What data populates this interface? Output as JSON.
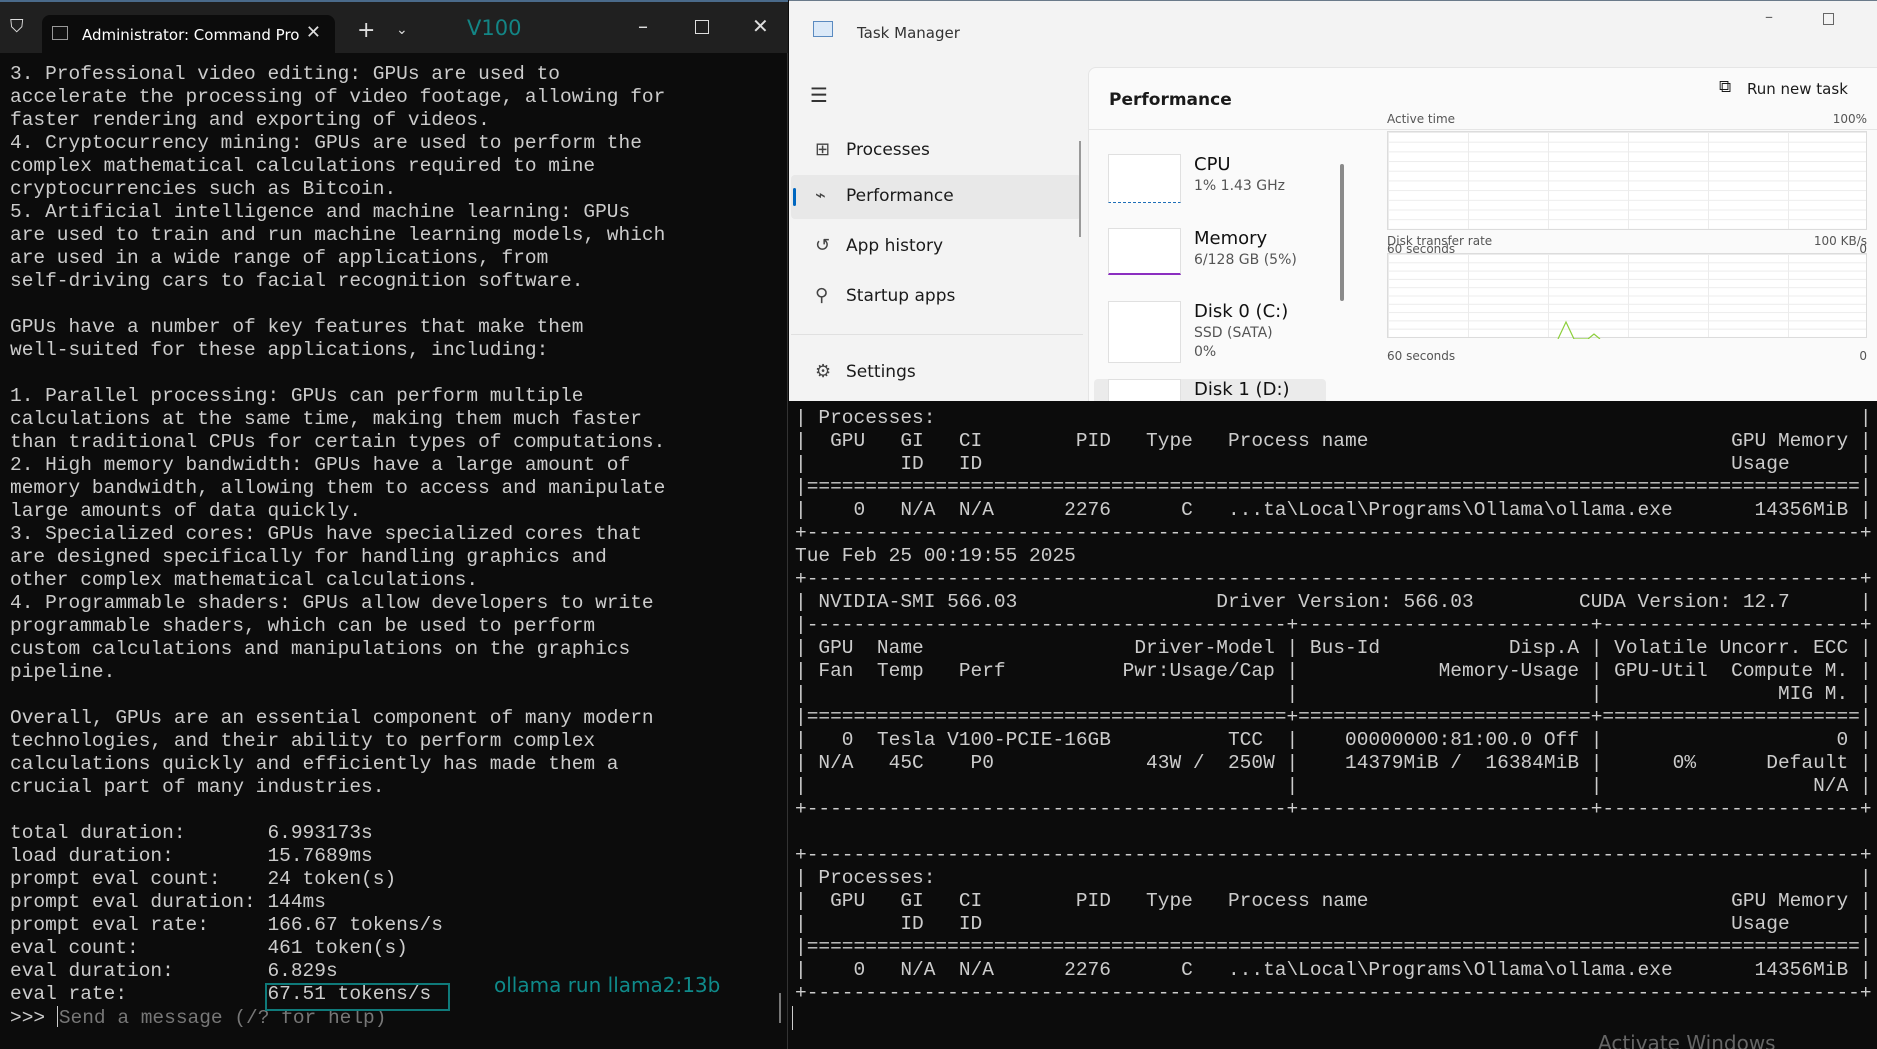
{
  "terminal": {
    "tab_title": "Administrator: Command Pro",
    "annotation_label": "V100",
    "lines": [
      "3. Professional video editing: GPUs are used to",
      "accelerate the processing of video footage, allowing for",
      "faster rendering and exporting of videos.",
      "4. Cryptocurrency mining: GPUs are used to perform the",
      "complex mathematical calculations required to mine",
      "cryptocurrencies such as Bitcoin.",
      "5. Artificial intelligence and machine learning: GPUs",
      "are used to train and run machine learning models, which",
      "are used in a wide range of applications, from",
      "self-driving cars to facial recognition software.",
      "",
      "GPUs have a number of key features that make them",
      "well-suited for these applications, including:",
      "",
      "1. Parallel processing: GPUs can perform multiple",
      "calculations at the same time, making them much faster",
      "than traditional CPUs for certain types of computations.",
      "2. High memory bandwidth: GPUs have a large amount of",
      "memory bandwidth, allowing them to access and manipulate",
      "large amounts of data quickly.",
      "3. Specialized cores: GPUs have specialized cores that",
      "are designed specifically for handling graphics and",
      "other complex mathematical calculations.",
      "4. Programmable shaders: GPUs allow developers to write",
      "programmable shaders, which can be used to perform",
      "custom calculations and manipulations on the graphics",
      "pipeline.",
      "",
      "Overall, GPUs are an essential component of many modern",
      "technologies, and their ability to perform complex",
      "calculations quickly and efficiently has made them a",
      "crucial part of many industries.",
      ""
    ],
    "stats": [
      {
        "label": "total duration:",
        "value": "6.993173s"
      },
      {
        "label": "load duration:",
        "value": "15.7689ms"
      },
      {
        "label": "prompt eval count:",
        "value": "24 token(s)"
      },
      {
        "label": "prompt eval duration:",
        "value": "144ms"
      },
      {
        "label": "prompt eval rate:",
        "value": "166.67 tokens/s"
      },
      {
        "label": "eval count:",
        "value": "461 token(s)"
      },
      {
        "label": "eval duration:",
        "value": "6.829s"
      },
      {
        "label": "eval rate:",
        "value": "67.51 tokens/s"
      }
    ],
    "prompt": ">>> ",
    "input_placeholder": "Send a message (/? for help)",
    "model_annotation": "ollama run llama2:13b",
    "accent_color": "#0f8a8a"
  },
  "task_manager": {
    "title": "Task Manager",
    "nav": [
      {
        "label": "Processes",
        "icon": "processes-icon"
      },
      {
        "label": "Performance",
        "icon": "performance-icon",
        "selected": true
      },
      {
        "label": "App history",
        "icon": "app-history-icon"
      },
      {
        "label": "Startup apps",
        "icon": "startup-apps-icon"
      },
      {
        "label": "Settings",
        "icon": "gear-icon"
      }
    ],
    "header": "Performance",
    "run_new_task": "Run new task",
    "resources": [
      {
        "name": "CPU",
        "sub": "1% 1.43 GHz"
      },
      {
        "name": "Memory",
        "sub": "6/128 GB (5%)"
      },
      {
        "name": "Disk 0 (C:)",
        "sub": "SSD (SATA)",
        "sub2": "0%"
      },
      {
        "name": "Disk 1 (D:)"
      }
    ],
    "graphs": [
      {
        "title": "Active time",
        "max": "100%",
        "span": "60 seconds",
        "min": "0"
      },
      {
        "title": "Disk transfer rate",
        "max": "100 KB/s",
        "span": "60 seconds",
        "min": "0"
      }
    ]
  },
  "nvidia_terminal": {
    "lines": [
      "| Processes:                                                                               |",
      "|  GPU   GI   CI        PID   Type   Process name                               GPU Memory |",
      "|        ID   ID                                                                Usage      |",
      "|==========================================================================================|",
      "|    0   N/A  N/A      2276      C   ...ta\\Local\\Programs\\Ollama\\ollama.exe       14356MiB |",
      "+------------------------------------------------------------------------------------------+",
      "Tue Feb 25 00:19:55 2025",
      "+------------------------------------------------------------------------------------------+",
      "| NVIDIA-SMI 566.03                 Driver Version: 566.03         CUDA Version: 12.7      |",
      "|-----------------------------------------+-------------------------+----------------------+",
      "| GPU  Name                  Driver-Model | Bus-Id           Disp.A | Volatile Uncorr. ECC |",
      "| Fan  Temp   Perf          Pwr:Usage/Cap |            Memory-Usage | GPU-Util  Compute M. |",
      "|                                         |                         |               MIG M. |",
      "|=========================================+=========================+======================|",
      "|   0  Tesla V100-PCIE-16GB          TCC  |    00000000:81:00.0 Off |                    0 |",
      "| N/A   45C    P0             43W /  250W |    14379MiB /  16384MiB |      0%      Default |",
      "|                                         |                         |                  N/A |",
      "+-----------------------------------------+-------------------------+----------------------+",
      "",
      "+------------------------------------------------------------------------------------------+",
      "| Processes:                                                                               |",
      "|  GPU   GI   CI        PID   Type   Process name                               GPU Memory |",
      "|        ID   ID                                                                Usage      |",
      "|==========================================================================================|",
      "|    0   N/A  N/A      2276      C   ...ta\\Local\\Programs\\Ollama\\ollama.exe       14356MiB |",
      "+------------------------------------------------------------------------------------------+"
    ],
    "watermark": "Activate Windows"
  }
}
